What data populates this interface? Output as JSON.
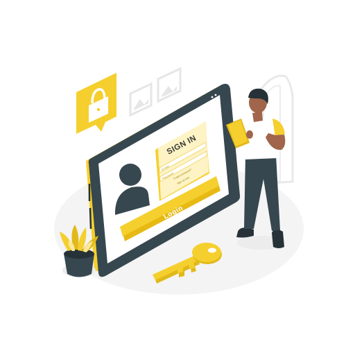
{
  "form": {
    "title": "SIGN IN",
    "username_placeholder": "E-mail",
    "password_placeholder": "Password",
    "forgot_link": "Forgot password?",
    "signup_link": "Sign up now"
  },
  "login_button": {
    "label": "Login"
  },
  "colors": {
    "accent": "#f5cf2e",
    "accent_light": "#fbe89a",
    "dark": "#37474f",
    "panel_light": "#fdf3c4"
  },
  "icons": [
    "padlock-icon",
    "image-icon",
    "user-avatar-icon",
    "key-icon",
    "plant-icon"
  ]
}
